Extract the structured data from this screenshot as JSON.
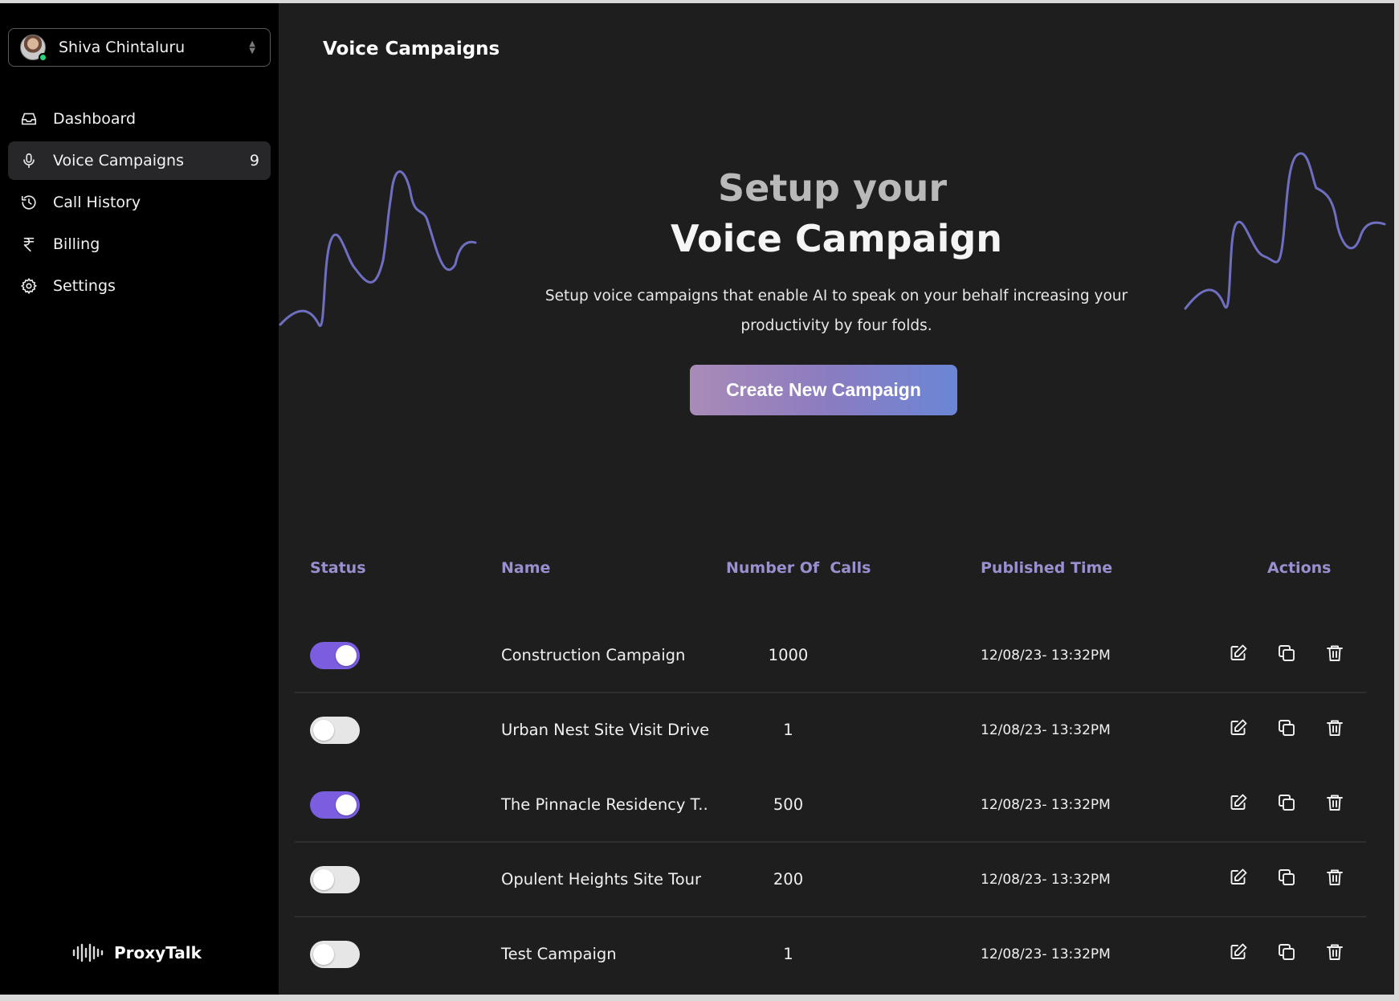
{
  "user": {
    "name": "Shiva Chintaluru"
  },
  "nav": [
    {
      "label": "Dashboard",
      "icon": "inbox-icon",
      "active": false
    },
    {
      "label": "Voice Campaigns",
      "icon": "microphone-icon",
      "active": true,
      "count": "9"
    },
    {
      "label": "Call History",
      "icon": "history-icon",
      "active": false
    },
    {
      "label": "Billing",
      "icon": "rupee-icon",
      "active": false
    },
    {
      "label": "Settings",
      "icon": "gear-icon",
      "active": false
    }
  ],
  "brand": {
    "name": "ProxyTalk"
  },
  "page": {
    "title": "Voice Campaigns"
  },
  "hero": {
    "line1": "Setup your",
    "line2": "Voice Campaign",
    "description": "Setup voice campaigns that enable AI to speak on your behalf increasing your productivity by four folds.",
    "cta": "Create New Campaign"
  },
  "table": {
    "headers": {
      "status": "Status",
      "name": "Name",
      "calls": "Number Of  Calls",
      "published": "Published Time",
      "actions": "Actions"
    },
    "rows": [
      {
        "active": true,
        "name": "Construction Campaign",
        "calls": "1000",
        "published": "12/08/23- 13:32PM"
      },
      {
        "active": false,
        "name": "Urban Nest Site Visit Drive",
        "calls": "1",
        "published": "12/08/23- 13:32PM"
      },
      {
        "active": true,
        "name": "The Pinnacle Residency T..",
        "calls": "500",
        "published": "12/08/23- 13:32PM"
      },
      {
        "active": false,
        "name": "Opulent Heights Site Tour",
        "calls": "200",
        "published": "12/08/23- 13:32PM"
      },
      {
        "active": false,
        "name": "Test Campaign",
        "calls": "1",
        "published": "12/08/23- 13:32PM"
      }
    ]
  },
  "colors": {
    "accent": "#7b5ee0",
    "header_text": "#9a8fcf",
    "wave": "#6e6fc0"
  }
}
